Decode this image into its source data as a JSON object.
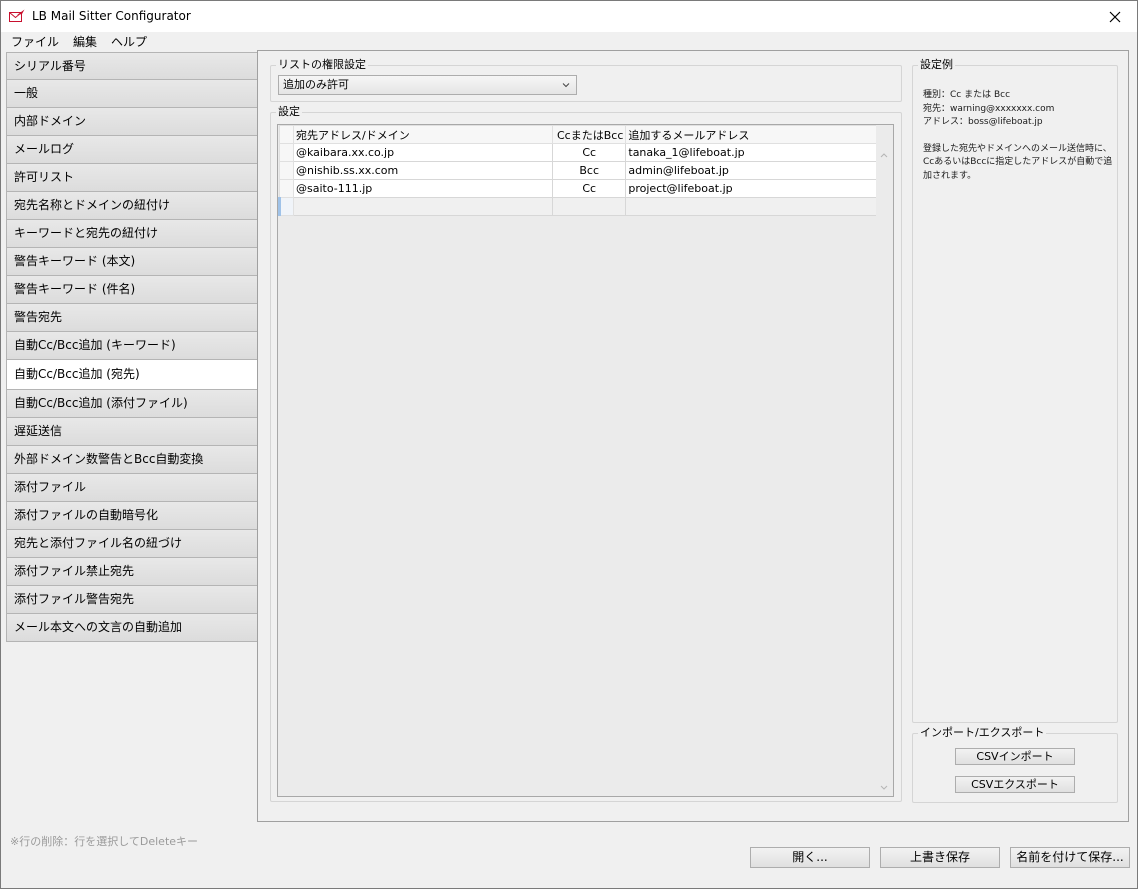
{
  "window": {
    "title": "LB Mail Sitter Configurator"
  },
  "menu": [
    "ファイル",
    "編集",
    "ヘルプ"
  ],
  "sidebar": {
    "items": [
      "シリアル番号",
      "一般",
      "内部ドメイン",
      "メールログ",
      "許可リスト",
      "宛先名称とドメインの紐付け",
      "キーワードと宛先の紐付け",
      "警告キーワード (本文)",
      "警告キーワード (件名)",
      "警告宛先",
      "自動Cc/Bcc追加 (キーワード)",
      "自動Cc/Bcc追加 (宛先)",
      "自動Cc/Bcc追加 (添付ファイル)",
      "遅延送信",
      "外部ドメイン数警告とBcc自動変換",
      "添付ファイル",
      "添付ファイルの自動暗号化",
      "宛先と添付ファイル名の紐づけ",
      "添付ファイル禁止宛先",
      "添付ファイル警告宛先",
      "メール本文への文言の自動追加"
    ],
    "active_index": 11
  },
  "permission": {
    "legend": "リストの権限設定",
    "selected": "追加のみ許可"
  },
  "settings": {
    "legend": "設定",
    "columns": [
      "宛先アドレス/ドメイン",
      "CcまたはBcc",
      "追加するメールアドレス"
    ],
    "rows": [
      [
        "@kaibara.xx.co.jp",
        "Cc",
        "tanaka_1@lifeboat.jp"
      ],
      [
        "@nishib.ss.xx.com",
        "Bcc",
        "admin@lifeboat.jp"
      ],
      [
        "@saito-111.jp",
        "Cc",
        "project@lifeboat.jp"
      ]
    ]
  },
  "example": {
    "legend": "設定例",
    "line1": "種別：Cc または Bcc",
    "line2": "宛先：warning@xxxxxxx.com",
    "line3": "アドレス：boss@lifeboat.jp",
    "desc1": "登録した宛先やドメインへのメール送信時に、",
    "desc2": "CcあるいはBccに指定したアドレスが自動で追",
    "desc3": "加されます。"
  },
  "import_export": {
    "legend": "インポート/エクスポート",
    "import_label": "CSVインポート",
    "export_label": "CSVエクスポート"
  },
  "hint": "※行の削除：行を選択してDeleteキー",
  "buttons": {
    "open": "開く...",
    "overwrite_save": "上書き保存",
    "save_as": "名前を付けて保存..."
  },
  "colors": {
    "accent": "#c8102e",
    "new_row_marker": "#9fc2e8"
  }
}
